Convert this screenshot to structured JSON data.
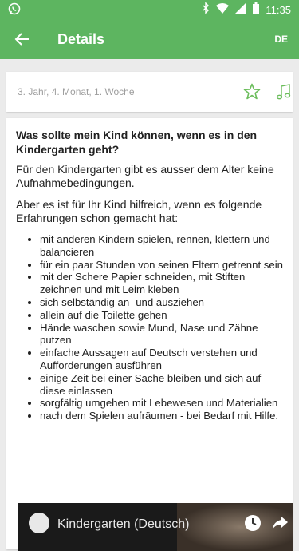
{
  "status_bar": {
    "time": "11:35",
    "icons": [
      "whatsapp-icon",
      "bluetooth-icon",
      "wifi-icon",
      "signal-icon",
      "battery-icon"
    ]
  },
  "app_bar": {
    "title": "Details",
    "language": "DE",
    "color": "#5db560"
  },
  "week_card": {
    "label": "3. Jahr, 4. Monat, 1. Woche",
    "icons": [
      "star-outline-icon",
      "music-note-icon"
    ]
  },
  "content": {
    "heading": "Was sollte mein Kind können, wenn es in den Kindergarten geht?",
    "paragraph1": "Für den Kindergarten gibt es ausser dem Alter keine Aufnahmebedingungen.",
    "paragraph2": "Aber es ist für Ihr Kind hilfreich, wenn es folgende Erfahrungen schon gemacht hat:",
    "bullets": [
      "mit anderen Kindern spielen, rennen, klettern und balancieren",
      "für ein paar Stunden von seinen Eltern getrennt sein",
      "mit der Schere Papier schneiden, mit Stiften zeichnen und mit Leim kleben",
      "sich selbständig an- und ausziehen",
      "allein auf die Toilette gehen",
      "Hände waschen sowie Mund, Nase und Zähne putzen",
      "einfache Aussagen auf Deutsch verstehen und Aufforderungen ausführen",
      "einige Zeit bei einer Sache bleiben und sich auf diese einlassen",
      "sorgfältig umgehen mit Lebewesen und Materialien",
      "nach dem Spielen aufräumen - bei Bedarf mit Hilfe."
    ]
  },
  "video": {
    "title": "Kindergarten (Deutsch)",
    "icons": [
      "watch-later-icon",
      "share-icon"
    ]
  }
}
